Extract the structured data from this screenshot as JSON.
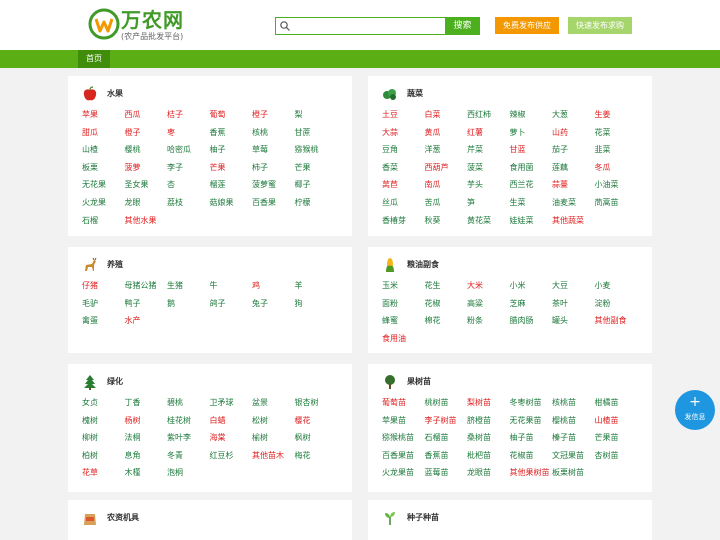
{
  "header": {
    "logo_title": "万农网",
    "logo_sub": "(农产品批发平台)",
    "search_placeholder": "",
    "search_button": "搜索",
    "publish_supply": "免费发布供应",
    "publish_buy": "快速发布求购"
  },
  "nav": {
    "home": "首页"
  },
  "fab": {
    "plus": "+",
    "label": "发信息"
  },
  "colors": {
    "brand_green": "#5cae15",
    "item_green": "#1e7a3c",
    "item_red": "#e02020",
    "orange": "#f39800",
    "fab_blue": "#1e96e0"
  },
  "sections": [
    {
      "id": "fruit",
      "title": "水果",
      "icon": "apple-icon",
      "items": [
        {
          "t": "苹果",
          "red": true
        },
        {
          "t": "西瓜",
          "red": true
        },
        {
          "t": "桔子",
          "red": true
        },
        {
          "t": "葡萄",
          "red": true
        },
        {
          "t": "橙子",
          "red": true
        },
        {
          "t": "梨",
          "red": false
        },
        {
          "t": "甜瓜",
          "red": true
        },
        {
          "t": "橙子",
          "red": true
        },
        {
          "t": "枣",
          "red": true
        },
        {
          "t": "香蕉",
          "red": false
        },
        {
          "t": "核桃",
          "red": false
        },
        {
          "t": "甘蔗",
          "red": false
        },
        {
          "t": "山楂",
          "red": false
        },
        {
          "t": "樱桃",
          "red": false
        },
        {
          "t": "哈密瓜",
          "red": false
        },
        {
          "t": "柚子",
          "red": false
        },
        {
          "t": "草莓",
          "red": false
        },
        {
          "t": "猕猴桃",
          "red": false
        },
        {
          "t": "板栗",
          "red": false
        },
        {
          "t": "菠萝",
          "red": true
        },
        {
          "t": "李子",
          "red": false
        },
        {
          "t": "芒果",
          "red": true
        },
        {
          "t": "柿子",
          "red": false
        },
        {
          "t": "芒果",
          "red": false
        },
        {
          "t": "无花果",
          "red": false
        },
        {
          "t": "圣女果",
          "red": false
        },
        {
          "t": "杏",
          "red": false
        },
        {
          "t": "榴莲",
          "red": false
        },
        {
          "t": "菠萝蜜",
          "red": false
        },
        {
          "t": "椰子",
          "red": false
        },
        {
          "t": "火龙果",
          "red": false
        },
        {
          "t": "龙眼",
          "red": false
        },
        {
          "t": "荔枝",
          "red": false
        },
        {
          "t": "菇娘果",
          "red": false
        },
        {
          "t": "百香果",
          "red": false
        },
        {
          "t": "柠檬",
          "red": false
        },
        {
          "t": "石榴",
          "red": false
        },
        {
          "t": "其他水果",
          "red": true
        }
      ]
    },
    {
      "id": "veg",
      "title": "蔬菜",
      "icon": "vegetable-icon",
      "items": [
        {
          "t": "土豆",
          "red": true
        },
        {
          "t": "白菜",
          "red": true
        },
        {
          "t": "西红柿",
          "red": false
        },
        {
          "t": "辣椒",
          "red": false
        },
        {
          "t": "大葱",
          "red": false
        },
        {
          "t": "生姜",
          "red": true
        },
        {
          "t": "大蒜",
          "red": true
        },
        {
          "t": "黄瓜",
          "red": true
        },
        {
          "t": "红薯",
          "red": true
        },
        {
          "t": "萝卜",
          "red": false
        },
        {
          "t": "山药",
          "red": true
        },
        {
          "t": "花菜",
          "red": false
        },
        {
          "t": "豆角",
          "red": false
        },
        {
          "t": "洋葱",
          "red": false
        },
        {
          "t": "芹菜",
          "red": false
        },
        {
          "t": "甘蓝",
          "red": true
        },
        {
          "t": "茄子",
          "red": false
        },
        {
          "t": "韭菜",
          "red": false
        },
        {
          "t": "香菜",
          "red": false
        },
        {
          "t": "西葫芦",
          "red": true
        },
        {
          "t": "菠菜",
          "red": false
        },
        {
          "t": "食用菌",
          "red": false
        },
        {
          "t": "莲藕",
          "red": false
        },
        {
          "t": "冬瓜",
          "red": true
        },
        {
          "t": "莴苣",
          "red": true
        },
        {
          "t": "南瓜",
          "red": true
        },
        {
          "t": "芋头",
          "red": false
        },
        {
          "t": "西兰花",
          "red": false
        },
        {
          "t": "蒜薹",
          "red": true
        },
        {
          "t": "小油菜",
          "red": false
        },
        {
          "t": "丝瓜",
          "red": false
        },
        {
          "t": "苦瓜",
          "red": false
        },
        {
          "t": "笋",
          "red": false
        },
        {
          "t": "生菜",
          "red": false
        },
        {
          "t": "油麦菜",
          "red": false
        },
        {
          "t": "茼蒿苗",
          "red": false
        },
        {
          "t": "香椿芽",
          "red": false
        },
        {
          "t": "秋葵",
          "red": false
        },
        {
          "t": "黄花菜",
          "red": false
        },
        {
          "t": "娃娃菜",
          "red": false
        },
        {
          "t": "其他蔬菜",
          "red": true
        }
      ]
    },
    {
      "id": "breed",
      "title": "养殖",
      "icon": "deer-icon",
      "items": [
        {
          "t": "仔猪",
          "red": true
        },
        {
          "t": "母猪公猪",
          "red": false
        },
        {
          "t": "生猪",
          "red": false
        },
        {
          "t": "牛",
          "red": false
        },
        {
          "t": "鸡",
          "red": true
        },
        {
          "t": "羊",
          "red": false
        },
        {
          "t": "毛驴",
          "red": false
        },
        {
          "t": "鸭子",
          "red": false
        },
        {
          "t": "鹅",
          "red": false
        },
        {
          "t": "鸽子",
          "red": false
        },
        {
          "t": "兔子",
          "red": false
        },
        {
          "t": "狗",
          "red": false
        },
        {
          "t": "禽蛋",
          "red": false
        },
        {
          "t": "水产",
          "red": true
        }
      ]
    },
    {
      "id": "grain",
      "title": "粮油副食",
      "icon": "corn-icon",
      "items": [
        {
          "t": "玉米",
          "red": false
        },
        {
          "t": "花生",
          "red": false
        },
        {
          "t": "大米",
          "red": true
        },
        {
          "t": "小米",
          "red": false
        },
        {
          "t": "大豆",
          "red": false
        },
        {
          "t": "小麦",
          "red": false
        },
        {
          "t": "面粉",
          "red": false
        },
        {
          "t": "花椒",
          "red": false
        },
        {
          "t": "高粱",
          "red": false
        },
        {
          "t": "芝麻",
          "red": false
        },
        {
          "t": "茶叶",
          "red": false
        },
        {
          "t": "淀粉",
          "red": false
        },
        {
          "t": "蜂蜜",
          "red": false
        },
        {
          "t": "棉花",
          "red": false
        },
        {
          "t": "粉条",
          "red": false
        },
        {
          "t": "腊肉肠",
          "red": false
        },
        {
          "t": "罐头",
          "red": false
        },
        {
          "t": "其他副食",
          "red": true
        },
        {
          "t": "食用油",
          "red": true
        }
      ]
    },
    {
      "id": "green",
      "title": "绿化",
      "icon": "pine-tree-icon",
      "items": [
        {
          "t": "女贞",
          "red": false
        },
        {
          "t": "丁香",
          "red": false
        },
        {
          "t": "碧桃",
          "red": false
        },
        {
          "t": "卫矛球",
          "red": false
        },
        {
          "t": "盆景",
          "red": false
        },
        {
          "t": "银杏树",
          "red": false
        },
        {
          "t": "槐树",
          "red": false
        },
        {
          "t": "杨树",
          "red": true
        },
        {
          "t": "桂花树",
          "red": false
        },
        {
          "t": "白蜡",
          "red": true
        },
        {
          "t": "松树",
          "red": false
        },
        {
          "t": "樱花",
          "red": true
        },
        {
          "t": "柳树",
          "red": false
        },
        {
          "t": "法桐",
          "red": false
        },
        {
          "t": "紫叶李",
          "red": false
        },
        {
          "t": "海棠",
          "red": true
        },
        {
          "t": "榆树",
          "red": false
        },
        {
          "t": "枫树",
          "red": false
        },
        {
          "t": "柏树",
          "red": false
        },
        {
          "t": "息角",
          "red": false
        },
        {
          "t": "冬青",
          "red": false
        },
        {
          "t": "红豆杉",
          "red": false
        },
        {
          "t": "其他苗木",
          "red": true
        },
        {
          "t": "梅花",
          "red": false
        },
        {
          "t": "花草",
          "red": true
        },
        {
          "t": "木槿",
          "red": false
        },
        {
          "t": "泡桐",
          "red": false
        }
      ]
    },
    {
      "id": "seedling",
      "title": "果树苗",
      "icon": "tree-icon",
      "items": [
        {
          "t": "葡萄苗",
          "red": true
        },
        {
          "t": "桃树苗",
          "red": false
        },
        {
          "t": "梨树苗",
          "red": true
        },
        {
          "t": "冬枣树苗",
          "red": false
        },
        {
          "t": "核桃苗",
          "red": false
        },
        {
          "t": "柑橘苗",
          "red": false
        },
        {
          "t": "苹果苗",
          "red": false
        },
        {
          "t": "李子树苗",
          "red": true
        },
        {
          "t": "脐橙苗",
          "red": false
        },
        {
          "t": "无花果苗",
          "red": false
        },
        {
          "t": "樱桃苗",
          "red": false
        },
        {
          "t": "山楂苗",
          "red": true
        },
        {
          "t": "猕猴桃苗",
          "red": false
        },
        {
          "t": "石榴苗",
          "red": false
        },
        {
          "t": "桑树苗",
          "red": false
        },
        {
          "t": "柚子苗",
          "red": false
        },
        {
          "t": "榛子苗",
          "red": false
        },
        {
          "t": "芒果苗",
          "red": false
        },
        {
          "t": "百香果苗",
          "red": false
        },
        {
          "t": "香蕉苗",
          "red": false
        },
        {
          "t": "枇杷苗",
          "red": false
        },
        {
          "t": "花椒苗",
          "red": false
        },
        {
          "t": "文冠果苗",
          "red": false
        },
        {
          "t": "杏树苗",
          "red": false
        },
        {
          "t": "火龙果苗",
          "red": false
        },
        {
          "t": "蓝莓苗",
          "red": false
        },
        {
          "t": "龙眼苗",
          "red": false
        },
        {
          "t": "其他果树苗",
          "red": true
        },
        {
          "t": "板栗树苗",
          "red": false
        }
      ]
    },
    {
      "id": "agri",
      "title": "农资机具",
      "icon": "bag-icon",
      "items": []
    },
    {
      "id": "seed",
      "title": "种子种苗",
      "icon": "sprout-icon",
      "items": []
    }
  ]
}
